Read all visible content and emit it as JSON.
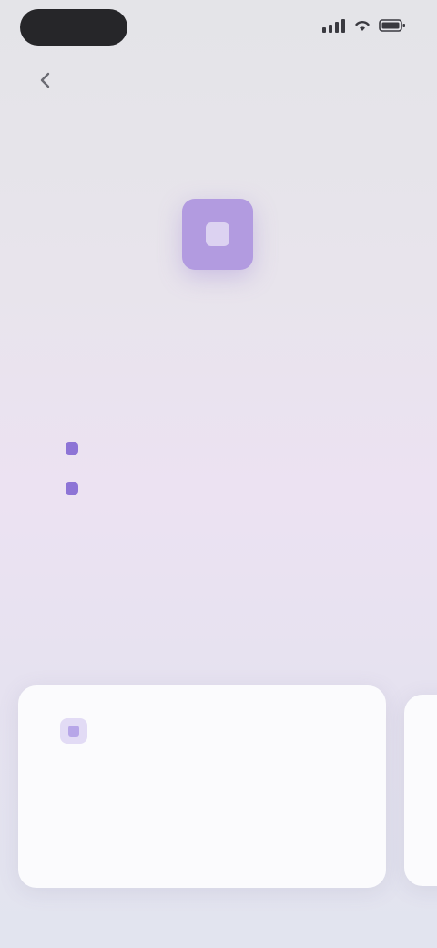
{
  "status_bar": {
    "time": "",
    "icons": [
      "signal-icon",
      "wifi-icon",
      "battery-icon"
    ]
  },
  "nav": {
    "back_icon": "chevron-left-icon",
    "title": ""
  },
  "app_tile": {
    "color": "#b29be0"
  },
  "heading": "",
  "checklist": [
    {
      "label": "",
      "status": "done"
    },
    {
      "label": "",
      "status": "done"
    },
    {
      "label": "",
      "status": "pending"
    },
    {
      "label": "",
      "status": "pending"
    }
  ],
  "cards": [
    {
      "icon": "info-icon",
      "title": "",
      "body": ""
    }
  ],
  "colors": {
    "accent": "#8d74d6",
    "card_background": "#fbfbfd"
  }
}
